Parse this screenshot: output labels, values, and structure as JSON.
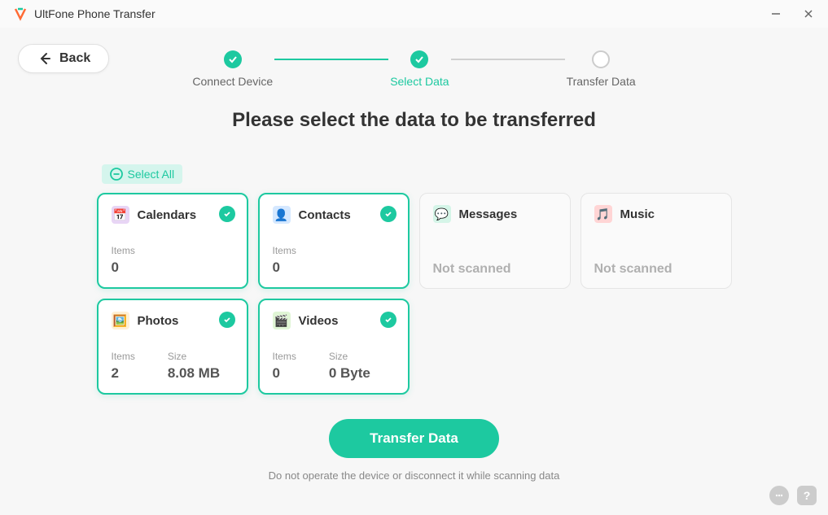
{
  "app": {
    "title": "UltFone Phone Transfer"
  },
  "back": {
    "label": "Back"
  },
  "stepper": {
    "steps": [
      {
        "label": "Connect Device",
        "state": "done"
      },
      {
        "label": "Select Data",
        "state": "active"
      },
      {
        "label": "Transfer Data",
        "state": "pending"
      }
    ]
  },
  "heading": "Please select the data to be transferred",
  "select_all": {
    "label": "Select All"
  },
  "cards": [
    {
      "title": "Calendars",
      "icon": "calendars-icon",
      "selected": true,
      "items_label": "Items",
      "items": "0",
      "size_label": null,
      "size": null,
      "not_scanned": false
    },
    {
      "title": "Contacts",
      "icon": "contacts-icon",
      "selected": true,
      "items_label": "Items",
      "items": "0",
      "size_label": null,
      "size": null,
      "not_scanned": false
    },
    {
      "title": "Messages",
      "icon": "messages-icon",
      "selected": false,
      "items_label": null,
      "items": null,
      "size_label": null,
      "size": null,
      "not_scanned": true,
      "not_scanned_label": "Not scanned"
    },
    {
      "title": "Music",
      "icon": "music-icon",
      "selected": false,
      "items_label": null,
      "items": null,
      "size_label": null,
      "size": null,
      "not_scanned": true,
      "not_scanned_label": "Not scanned"
    },
    {
      "title": "Photos",
      "icon": "photos-icon",
      "selected": true,
      "items_label": "Items",
      "items": "2",
      "size_label": "Size",
      "size": "8.08 MB",
      "not_scanned": false
    },
    {
      "title": "Videos",
      "icon": "videos-icon",
      "selected": true,
      "items_label": "Items",
      "items": "0",
      "size_label": "Size",
      "size": "0 Byte",
      "not_scanned": false
    }
  ],
  "transfer": {
    "label": "Transfer Data"
  },
  "hint": "Do not operate the device or disconnect it while scanning data",
  "colors": {
    "accent": "#1dc9a0"
  }
}
